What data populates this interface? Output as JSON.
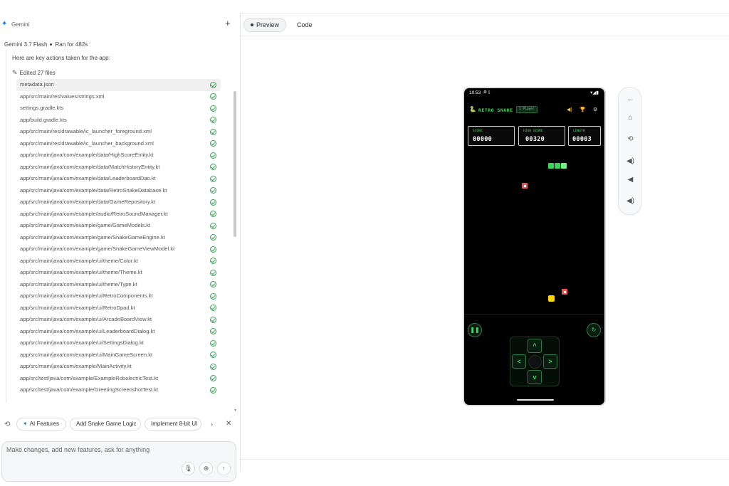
{
  "chat": {
    "title": "Gemini",
    "model": "Gemini 3.7 Flash",
    "run_status": "Ran for 482s",
    "actions_intro": "Here are key actions taken for the app:",
    "edited_label": "Edited 27 files",
    "files": [
      "metadata.json",
      "app/src/main/res/values/strings.xml",
      "settings.gradle.kts",
      "app/build.gradle.kts",
      "app/src/main/res/drawable/ic_launcher_foreground.xml",
      "app/src/main/res/drawable/ic_launcher_background.xml",
      "app/src/main/java/com/example/data/HighScoreEntity.kt",
      "app/src/main/java/com/example/data/MatchHistoryEntity.kt",
      "app/src/main/java/com/example/data/LeaderboardDao.kt",
      "app/src/main/java/com/example/data/RetroSnakeDatabase.kt",
      "app/src/main/java/com/example/data/GameRepository.kt",
      "app/src/main/java/com/example/audio/RetroSoundManager.kt",
      "app/src/main/java/com/example/game/GameModels.kt",
      "app/src/main/java/com/example/game/SnakeGameEngine.kt",
      "app/src/main/java/com/example/game/SnakeGameViewModel.kt",
      "app/src/main/java/com/example/ui/theme/Color.kt",
      "app/src/main/java/com/example/ui/theme/Theme.kt",
      "app/src/main/java/com/example/ui/theme/Type.kt",
      "app/src/main/java/com/example/ui/RetroComponents.kt",
      "app/src/main/java/com/example/ui/RetroDpad.kt",
      "app/src/main/java/com/example/ui/ArcadeBoardView.kt",
      "app/src/main/java/com/example/ui/LeaderboardDialog.kt",
      "app/src/main/java/com/example/ui/SettingsDialog.kt",
      "app/src/main/java/com/example/ui/MainGameScreen.kt",
      "app/src/main/java/com/example/MainActivity.kt",
      "app/src/test/java/com/example/ExampleRobolectricTest.kt",
      "app/src/test/java/com/example/GreetingScreenshotTest.kt"
    ],
    "suggestions": [
      "AI Features",
      "Add Snake Game Logic",
      "Implement 8-bit UI"
    ],
    "prompt_placeholder": "Make changes, add new features, ask for anything"
  },
  "preview": {
    "tabs": [
      "Preview",
      "Code"
    ],
    "active_tab": "Preview"
  },
  "device": {
    "time": "10:53",
    "game_title": "RETRO SNAKE",
    "player_badge": "1 Player",
    "stats": [
      {
        "label": "SCORE",
        "value": "00000"
      },
      {
        "label": "HIGH SCORE",
        "value": "00320"
      },
      {
        "label": "LENGTH",
        "value": "00003"
      }
    ]
  },
  "icons": {
    "add": "plus-icon",
    "pencil": "pencil-icon",
    "check": "check-circle-icon",
    "mic": "mic-icon",
    "attach": "add-circle-icon",
    "send": "arrow-up-icon",
    "pause": "pause-icon",
    "restart": "refresh-icon",
    "sound": "volume-icon",
    "trophy": "trophy-icon",
    "settings": "gear-icon"
  },
  "colors": {
    "accent": "#1a73e8",
    "success": "#2ea44f",
    "retro_green": "#3ddc5c",
    "food_red": "#f05555",
    "bonus_yellow": "#ffd600"
  }
}
